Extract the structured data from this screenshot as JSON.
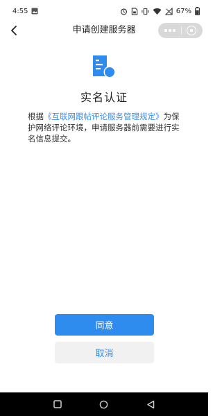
{
  "status_bar": {
    "time": "4:55",
    "battery": "67%",
    "sim_badge": "SIM"
  },
  "nav": {
    "title": "申请创建服务器"
  },
  "main": {
    "title": "实名认证",
    "description_prefix": "根据",
    "description_link": "《互联网跟帖评论服务管理规定》",
    "description_body": "为保护网络评论环境，申请服务器前需要进行实名信息提交。"
  },
  "buttons": {
    "agree": "同意",
    "cancel": "取消"
  },
  "colors": {
    "accent": "#2f8cef",
    "link": "#3a8fe8"
  },
  "icons": {
    "document": "doc-user-icon",
    "back": "back-chevron-icon",
    "more": "more-dots-icon",
    "close": "capsule-close-icon"
  }
}
